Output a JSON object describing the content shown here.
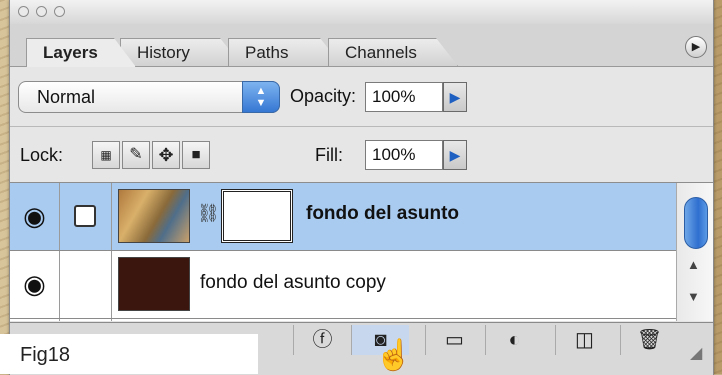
{
  "tabs": [
    {
      "label": "Layers"
    },
    {
      "label": "History"
    },
    {
      "label": "Paths"
    },
    {
      "label": "Channels"
    }
  ],
  "blend_mode": "Normal",
  "opacity": {
    "label": "Opacity:",
    "value": "100%"
  },
  "fill": {
    "label": "Fill:",
    "value": "100%"
  },
  "lock": {
    "label": "Lock:"
  },
  "layers": [
    {
      "name": "fondo del asunto",
      "selected": true
    },
    {
      "name": "fondo del asunto copy",
      "selected": false
    }
  ],
  "caption": "Fig18",
  "colors": {
    "selection": "#a9cbf0",
    "accent": "#3577d3"
  },
  "icons": [
    "eye-icon",
    "layer-mask-icon",
    "link-icon",
    "layer-style-icon",
    "add-mask-icon",
    "new-group-icon",
    "adjustment-layer-icon",
    "new-layer-icon",
    "trash-icon",
    "panel-menu-icon",
    "lock-transparent-icon",
    "lock-image-icon",
    "lock-position-icon",
    "lock-all-icon",
    "hand-cursor-icon"
  ]
}
